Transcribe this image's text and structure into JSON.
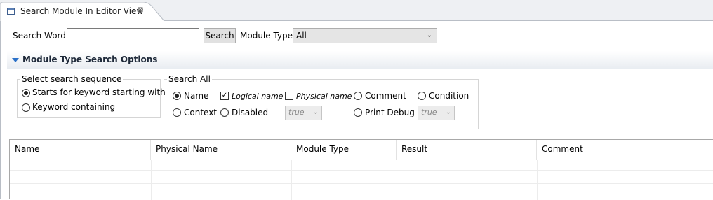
{
  "tab": {
    "title": "Search Module In Editor View",
    "close_symbol": "⊠"
  },
  "search": {
    "word_label": "Search Word:",
    "word_value": "",
    "button_label": "Search",
    "module_type_label": "Module Type",
    "module_type_value": "All",
    "chevron": "⌄"
  },
  "section": {
    "title": "Module Type Search Options"
  },
  "sequence": {
    "legend": "Select search sequence",
    "options": [
      {
        "label": "Starts for keyword starting with",
        "selected": true
      },
      {
        "label": "Keyword containing",
        "selected": false
      }
    ]
  },
  "search_all": {
    "legend": "Search All",
    "name": {
      "label": "Name",
      "selected": true
    },
    "logical": {
      "label": "Logical name",
      "checked": true
    },
    "physical": {
      "label": "Physical name",
      "checked": false
    },
    "comment": {
      "label": "Comment",
      "selected": false
    },
    "condition": {
      "label": "Condition",
      "selected": false
    },
    "context": {
      "label": "Context",
      "selected": false
    },
    "disabled": {
      "label": "Disabled",
      "selected": false
    },
    "disabled_select": "true",
    "print_debug": {
      "label": "Print Debug",
      "selected": false
    },
    "print_debug_select": "true"
  },
  "table": {
    "columns": [
      "Name",
      "Physical Name",
      "Module Type",
      "Result",
      "Comment"
    ]
  }
}
